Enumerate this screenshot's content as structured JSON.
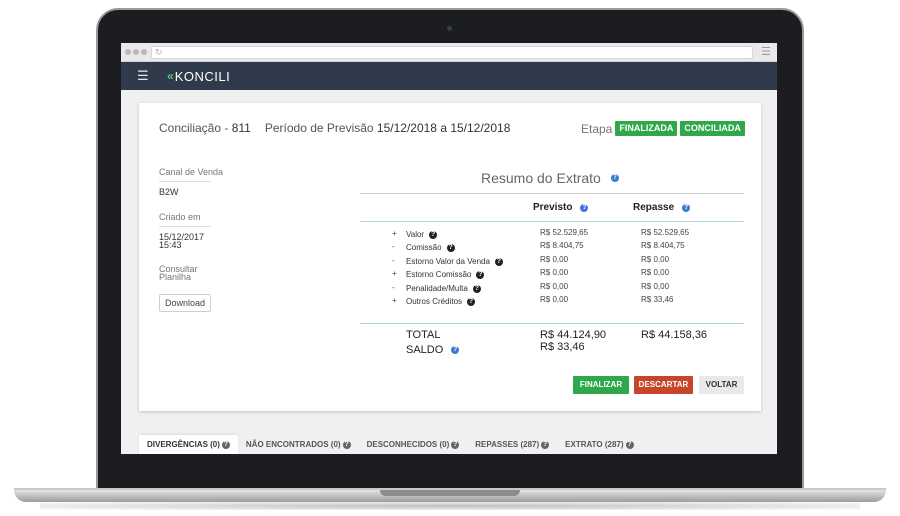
{
  "app": {
    "logo_mark": "«",
    "logo_text": "KONCILI"
  },
  "header": {
    "conciliacao_label": "Conciliação - ",
    "conciliacao_number": "811",
    "periodo_label": "Período de Previsão ",
    "periodo_value": "15/12/2018 a 15/12/2018",
    "etapa_label": "Etapa",
    "badges": [
      "FINALIZADA",
      "CONCILIADA"
    ]
  },
  "info": {
    "canal_label": "Canal de Venda",
    "canal_value": "B2W",
    "criado_label": "Criado em",
    "criado_date": "15/12/2017",
    "criado_time": "15:43",
    "planilha_label_1": "Consultar",
    "planilha_label_2": "Planilha",
    "download_label": "Download"
  },
  "summary": {
    "title": "Resumo do Extrato",
    "col_previsto": "Previsto",
    "col_repasse": "Repasse",
    "rows": [
      {
        "sign": "+",
        "label": "Valor",
        "previsto": "R$ 52.529,65",
        "repasse": "R$ 52.529,65"
      },
      {
        "sign": "-",
        "label": "Comissão",
        "previsto": "R$ 8.404,75",
        "repasse": "R$ 8.404,75"
      },
      {
        "sign": "-",
        "label": "Estorno Valor da Venda",
        "previsto": "R$ 0,00",
        "repasse": "R$ 0,00"
      },
      {
        "sign": "+",
        "label": "Estorno Comissão",
        "previsto": "R$ 0,00",
        "repasse": "R$ 0,00"
      },
      {
        "sign": "-",
        "label": "Penalidade/Multa",
        "previsto": "R$ 0,00",
        "repasse": "R$ 0,00"
      },
      {
        "sign": "+",
        "label": "Outros Créditos",
        "previsto": "R$ 0,00",
        "repasse": "R$ 33,46"
      }
    ],
    "total_label": "TOTAL",
    "saldo_label": "SALDO",
    "total_previsto": "R$ 44.124,90",
    "total_repasse": "R$ 44.158,36",
    "saldo_value": "R$ 33,46"
  },
  "actions": {
    "finalizar": "FINALIZAR",
    "descartar": "DESCARTAR",
    "voltar": "VOLTAR"
  },
  "tabs": [
    {
      "label": "DIVERGÊNCIAS (0)"
    },
    {
      "label": "NÃO ENCONTRADOS (0)"
    },
    {
      "label": "DESCONHECIDOS (0)"
    },
    {
      "label": "REPASSES (287)"
    },
    {
      "label": "EXTRATO (287)"
    }
  ],
  "colors": {
    "header_bg": "#2f3a4a",
    "success": "#2ea84a",
    "danger": "#c8442a",
    "info_icon": "#3a7bd5"
  },
  "icons": {
    "help": "question-circle-icon",
    "menu": "hamburger-icon",
    "reload": "reload-icon"
  }
}
